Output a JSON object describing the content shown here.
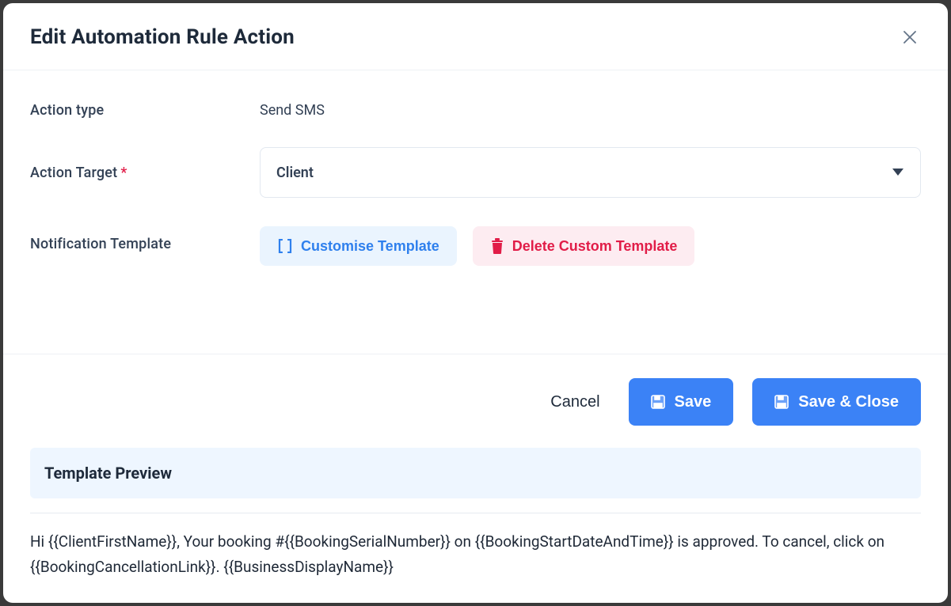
{
  "modal": {
    "title": "Edit Automation Rule Action"
  },
  "form": {
    "action_type_label": "Action type",
    "action_type_value": "Send SMS",
    "action_target_label": "Action Target",
    "action_target_value": "Client",
    "notification_template_label": "Notification Template",
    "customise_btn": "Customise Template",
    "delete_btn": "Delete Custom Template"
  },
  "footer": {
    "cancel": "Cancel",
    "save": "Save",
    "save_close": "Save & Close"
  },
  "preview": {
    "heading": "Template Preview",
    "body": "Hi {{ClientFirstName}}, Your booking #{{BookingSerialNumber}} on {{BookingStartDateAndTime}} is approved. To cancel, click on {{BookingCancellationLink}}. {{BusinessDisplayName}}"
  }
}
